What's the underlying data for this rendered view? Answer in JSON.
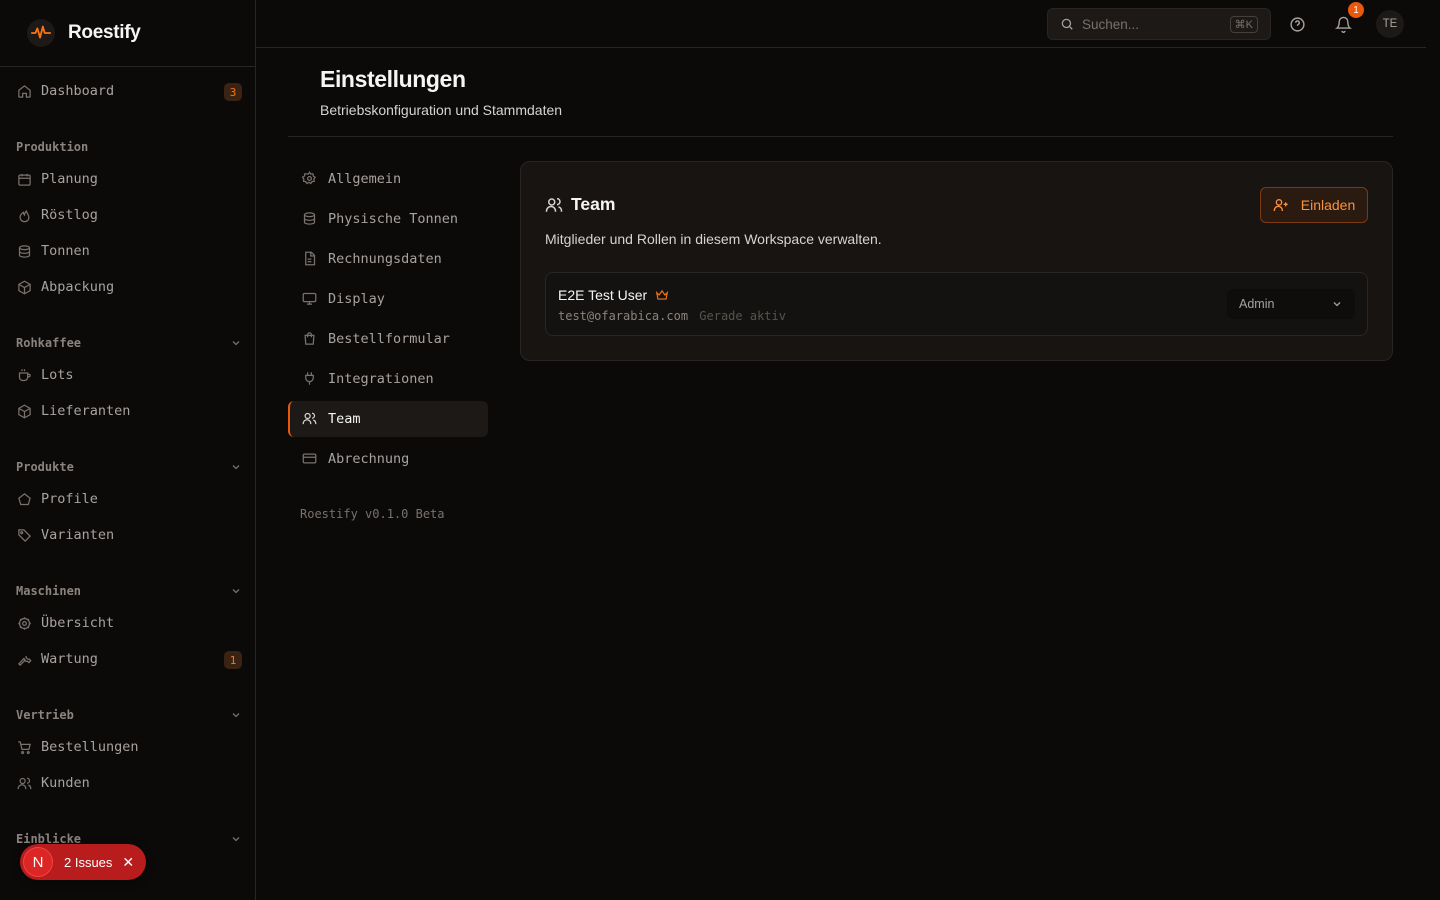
{
  "app": {
    "name": "Roestify"
  },
  "sidebar": {
    "dashboard": {
      "label": "Dashboard",
      "badge": "3"
    },
    "sections": {
      "produktion": "Produktion",
      "rohkaffee": "Rohkaffee",
      "produkte": "Produkte",
      "maschinen": "Maschinen",
      "vertrieb": "Vertrieb",
      "einblicke": "Einblicke"
    },
    "items": {
      "planung": "Planung",
      "roestlog": "Röstlog",
      "tonnen": "Tonnen",
      "abpackung": "Abpackung",
      "lots": "Lots",
      "lieferanten": "Lieferanten",
      "profile": "Profile",
      "varianten": "Varianten",
      "uebersicht": "Übersicht",
      "wartung": "Wartung",
      "wartung_badge": "1",
      "bestellungen": "Bestellungen",
      "kunden": "Kunden"
    }
  },
  "issues": {
    "letter": "N",
    "label": "2 Issues"
  },
  "topbar": {
    "search_placeholder": "Suchen...",
    "search_shortcut": "⌘K",
    "notification_count": "1",
    "avatar_initials": "TE"
  },
  "page": {
    "title": "Einstellungen",
    "subtitle": "Betriebskonfiguration und Stammdaten"
  },
  "settings_nav": {
    "allgemein": "Allgemein",
    "physische_tonnen": "Physische Tonnen",
    "rechnungsdaten": "Rechnungsdaten",
    "display": "Display",
    "bestellformular": "Bestellformular",
    "integrationen": "Integrationen",
    "team": "Team",
    "abrechnung": "Abrechnung",
    "active": "team"
  },
  "version": "Roestify v0.1.0 Beta",
  "team_card": {
    "title": "Team",
    "description": "Mitglieder und Rollen in diesem Workspace verwalten.",
    "invite_label": "Einladen",
    "members": [
      {
        "name": "E2E Test User",
        "email": "test@ofarabica.com",
        "status": "Gerade aktiv",
        "role": "Admin",
        "owner_icon": "crown-icon"
      }
    ]
  },
  "colors": {
    "accent": "#ea580c",
    "background": "#0c0a09",
    "card": "#171412",
    "danger": "#b91c1c"
  }
}
